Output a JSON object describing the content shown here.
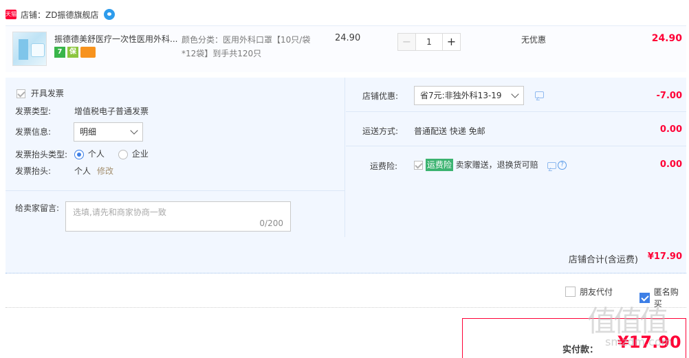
{
  "shop": {
    "badge": "天猫",
    "label": "店铺：ZD振德旗舰店"
  },
  "item": {
    "title": "振德德美舒医疗一次性医用外科...",
    "services": [
      "7",
      "保"
    ],
    "sku": "颜色分类：医用外科口罩【10只/袋*12袋】到手共120只",
    "unit_price": "24.90",
    "quantity": "1",
    "qty_minus": "−",
    "qty_plus": "+",
    "promo": "无优惠",
    "line_total": "24.90"
  },
  "invoice": {
    "issue_label": "开具发票",
    "type_label": "发票类型:",
    "type_value": "增值税电子普通发票",
    "info_label": "发票信息:",
    "info_value": "明细",
    "header_type_label": "发票抬头类型:",
    "header_type_options": [
      "个人",
      "企业"
    ],
    "header_label": "发票抬头:",
    "header_value": "个人",
    "edit_link": "修改"
  },
  "message": {
    "label": "给卖家留言:",
    "placeholder": "选填,请先和商家协商一致",
    "counter": "0/200"
  },
  "discount": {
    "label": "店铺优惠:",
    "selected": "省7元:非独外科13-19",
    "amount": "-7.00"
  },
  "shipping": {
    "label": "运送方式:",
    "value": "普通配送 快递 免邮",
    "amount": "0.00"
  },
  "insurance": {
    "label": "运费险:",
    "badge": "运费险",
    "value": "卖家赠送，退换货可赔",
    "help": "?",
    "amount": "0.00"
  },
  "shop_total": {
    "label": "店铺合计(含运费)",
    "value": "¥17.90"
  },
  "checkout_options": {
    "friend_pay": "朋友代付",
    "anonymous": "匿名购买"
  },
  "payment": {
    "label": "实付款：",
    "amount": "¥17.90"
  },
  "watermark": {
    "logo": "值值值",
    "url": "smzdm.com"
  },
  "colors": {
    "price_red": "#ff0036",
    "panel_bg": "#f2f7ff",
    "accent_blue": "#3d7fe6",
    "insurance_green": "#3cb371"
  }
}
